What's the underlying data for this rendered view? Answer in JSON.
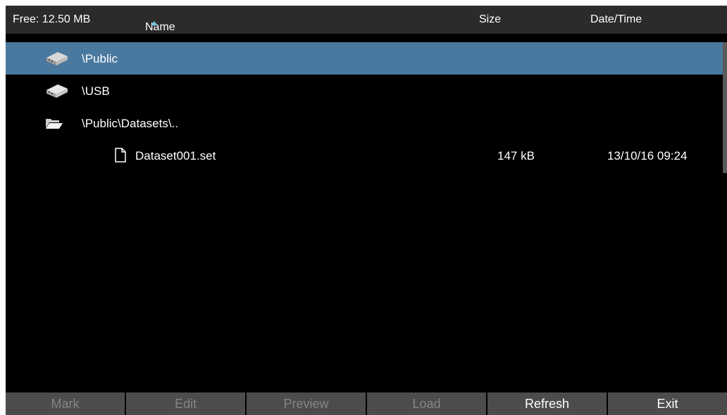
{
  "header": {
    "free": "Free: 12.50 MB",
    "name": "Name",
    "size": "Size",
    "datetime": "Date/Time"
  },
  "rows": [
    {
      "label": "\\Public",
      "icon": "drive-icon",
      "selected": true
    },
    {
      "label": "\\USB",
      "icon": "drive-icon",
      "selected": false
    },
    {
      "label": "\\Public\\Datasets\\..",
      "icon": "folder-open-icon",
      "selected": false
    },
    {
      "label": "Dataset001.set",
      "icon": "file-icon",
      "size": "147 kB",
      "datetime": "13/10/16 09:24",
      "selected": false
    }
  ],
  "softkeys": [
    {
      "label": "Mark",
      "enabled": false
    },
    {
      "label": "Edit",
      "enabled": false
    },
    {
      "label": "Preview",
      "enabled": false
    },
    {
      "label": "Load",
      "enabled": false
    },
    {
      "label": "Refresh",
      "enabled": true
    },
    {
      "label": "Exit",
      "enabled": true
    }
  ],
  "colors": {
    "selected_row": "#4a79a0",
    "header_bg": "#2b2b2b",
    "softkey_bg": "#4c4c4c",
    "disabled_text": "#858585",
    "sort_arrow": "#6cc3e0"
  }
}
